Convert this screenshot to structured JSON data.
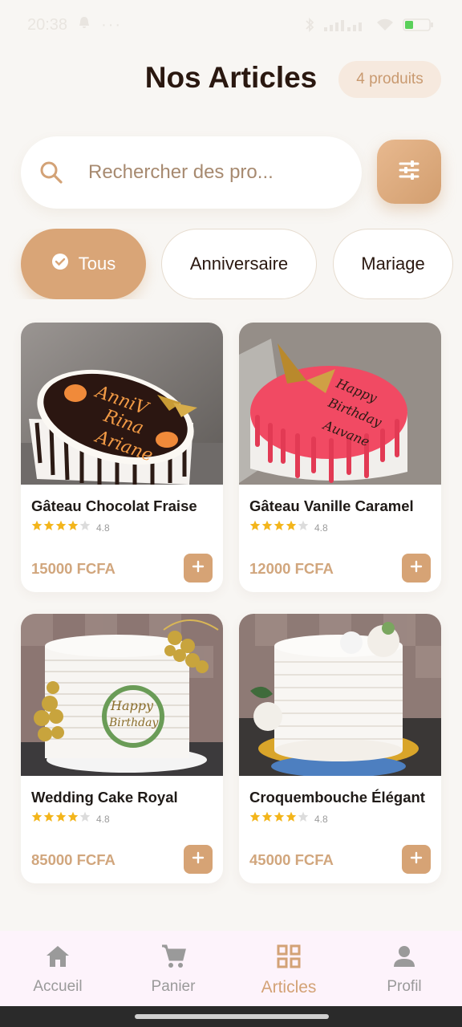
{
  "status_bar": {
    "time": "20:38",
    "battery": "34"
  },
  "header": {
    "title": "Nos Articles",
    "count_badge": "4 produits"
  },
  "search": {
    "placeholder": "Rechercher des pro..."
  },
  "categories": [
    {
      "label": "Tous",
      "active": true
    },
    {
      "label": "Anniversaire",
      "active": false
    },
    {
      "label": "Mariage",
      "active": false
    }
  ],
  "products": [
    {
      "name": "Gâteau Chocolat Fraise",
      "rating": "4.8",
      "stars_filled": 4,
      "price": "15000 FCFA"
    },
    {
      "name": "Gâteau Vanille Caramel",
      "rating": "4.8",
      "stars_filled": 4,
      "price": "12000 FCFA"
    },
    {
      "name": "Wedding Cake Royal",
      "rating": "4.8",
      "stars_filled": 4,
      "price": "85000 FCFA"
    },
    {
      "name": "Croquembouche Élégant",
      "rating": "4.8",
      "stars_filled": 4,
      "price": "45000 FCFA"
    }
  ],
  "nav": [
    {
      "label": "Accueil",
      "icon": "home-icon",
      "active": false
    },
    {
      "label": "Panier",
      "icon": "cart-icon",
      "active": false
    },
    {
      "label": "Articles",
      "icon": "grid-icon",
      "active": true
    },
    {
      "label": "Profil",
      "icon": "person-icon",
      "active": false
    }
  ],
  "colors": {
    "accent": "#d6a375",
    "background": "#f8f6f3",
    "price": "#d1a67d",
    "star": "#f3b51b"
  }
}
